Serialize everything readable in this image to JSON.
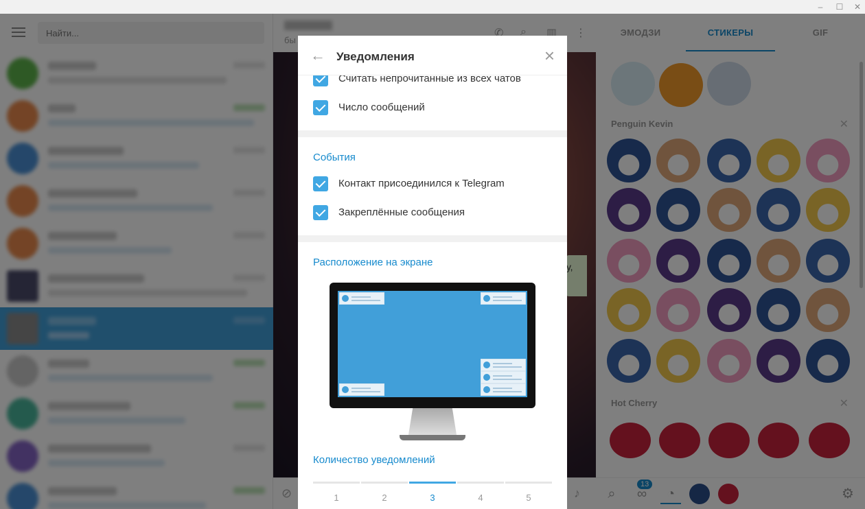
{
  "window": {
    "min_icon": "–",
    "max_icon": "☐",
    "close_icon": "✕"
  },
  "left": {
    "search_placeholder": "Найти..."
  },
  "chat_header": {
    "status": "бы",
    "icons": [
      "phone-icon",
      "search-icon",
      "columns-icon",
      "more-icon"
    ]
  },
  "bubble_text": "у,",
  "sticker_panel": {
    "tabs": [
      {
        "label": "ЭМОДЗИ"
      },
      {
        "label": "СТИКЕРЫ"
      },
      {
        "label": "GIF"
      }
    ],
    "active_tab": 1,
    "packs": [
      {
        "title": "Penguin Kevin"
      },
      {
        "title": "Hot Cherry"
      }
    ],
    "recent_badge": "13"
  },
  "modal": {
    "title": "Уведомления",
    "rows_top": [
      {
        "label": "Считать непрочитанные из всех чатов",
        "checked": true
      },
      {
        "label": "Число сообщений",
        "checked": true
      }
    ],
    "events": {
      "title": "События",
      "rows": [
        {
          "label": "Контакт присоединился к Telegram",
          "checked": true
        },
        {
          "label": "Закреплённые сообщения",
          "checked": true
        }
      ]
    },
    "position": {
      "title": "Расположение на экране"
    },
    "count": {
      "title": "Количество уведомлений",
      "options": [
        "1",
        "2",
        "3",
        "4",
        "5"
      ],
      "selected": "3"
    }
  },
  "colors": {
    "accent": "#168acd",
    "checkbox": "#40a7e3",
    "active_chat": "#419fd9"
  }
}
